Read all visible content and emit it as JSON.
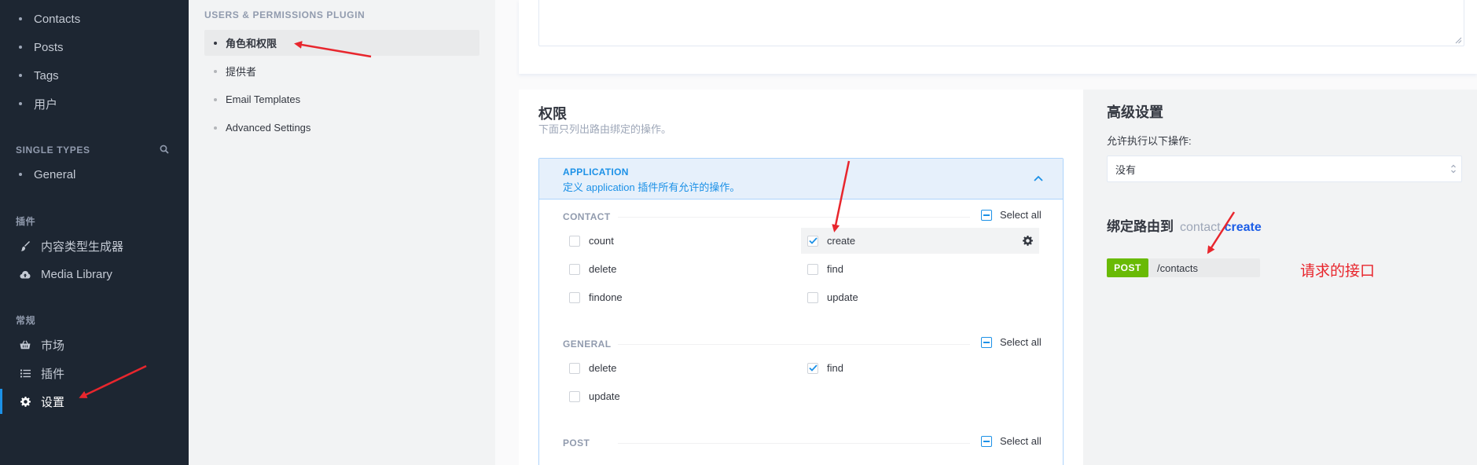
{
  "left_nav": {
    "content_types": [
      "Contacts",
      "Posts",
      "Tags",
      "用户"
    ],
    "single_types_title": "SINGLE TYPES",
    "single_types": [
      "General"
    ],
    "plugins_title": "插件",
    "plugins": [
      {
        "label": "内容类型生成器",
        "icon": "paintbrush-icon"
      },
      {
        "label": "Media Library",
        "icon": "cloud-upload-icon"
      }
    ],
    "general_title": "常规",
    "general": [
      {
        "label": "市场",
        "icon": "basket-icon"
      },
      {
        "label": "插件",
        "icon": "list-icon"
      },
      {
        "label": "设置",
        "icon": "gear-icon",
        "active": true
      }
    ]
  },
  "sub_nav": {
    "title": "USERS & PERMISSIONS PLUGIN",
    "items": [
      "角色和权限",
      "提供者",
      "Email Templates",
      "Advanced Settings"
    ],
    "active_index": 0
  },
  "permissions": {
    "title": "权限",
    "subtitle": "下面只列出路由绑定的操作。",
    "application": {
      "name": "APPLICATION",
      "description": "定义 application 插件所有允许的操作。"
    },
    "select_all_label": "Select all",
    "controllers": [
      {
        "name": "CONTACT",
        "actions": [
          {
            "label": "count",
            "checked": false
          },
          {
            "label": "create",
            "checked": true,
            "highlight": true
          },
          {
            "label": "delete",
            "checked": false
          },
          {
            "label": "find",
            "checked": false
          },
          {
            "label": "findone",
            "checked": false
          },
          {
            "label": "update",
            "checked": false
          }
        ]
      },
      {
        "name": "GENERAL",
        "actions": [
          {
            "label": "delete",
            "checked": false
          },
          {
            "label": "find",
            "checked": true
          },
          {
            "label": "update",
            "checked": false
          }
        ]
      },
      {
        "name": "POST",
        "actions": []
      }
    ]
  },
  "advanced": {
    "title": "高级设置",
    "policy_label": "允许执行以下操作:",
    "policy_value": "没有",
    "bound_title": "绑定路由到",
    "bound_controller": "contact",
    "bound_action": "create",
    "route_method": "POST",
    "route_path": "/contacts"
  },
  "annotation": {
    "text": "请求的接口",
    "color": "#e8262d"
  },
  "colors": {
    "sidebar_bg": "#1d2632",
    "accent": "#1c91e7",
    "post_badge": "#69ba05"
  }
}
